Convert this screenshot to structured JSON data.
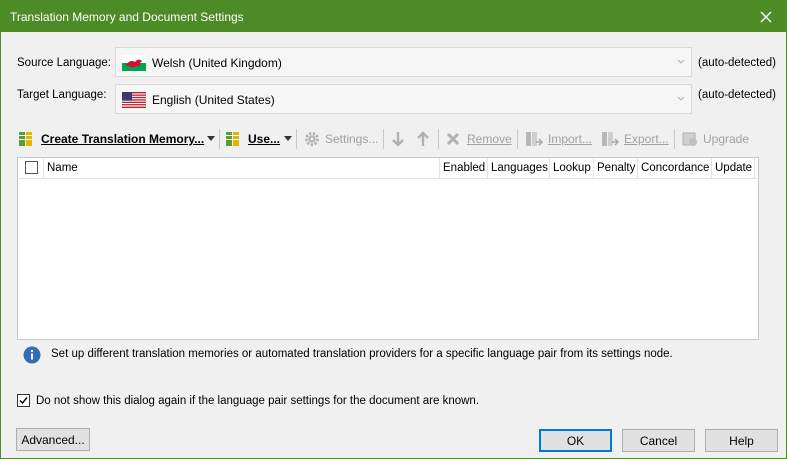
{
  "window": {
    "title": "Translation Memory and Document Settings"
  },
  "source": {
    "label": "Source Language:",
    "value": "Welsh (United Kingdom)",
    "status": "(auto-detected)"
  },
  "target": {
    "label": "Target Language:",
    "value": "English (United States)",
    "status": "(auto-detected)"
  },
  "toolbar": {
    "create": "Create Translation Memory...",
    "use": "Use...",
    "settings": "Settings...",
    "remove": "Remove",
    "import": "Import...",
    "export": "Export...",
    "upgrade": "Upgrade"
  },
  "grid": {
    "columns": [
      "Name",
      "Enabled",
      "Languages",
      "Lookup",
      "Penalty",
      "Concordance",
      "Update"
    ]
  },
  "info": {
    "text": "Set up different translation memories or automated translation providers for a specific language pair from its settings node."
  },
  "option": {
    "dont_show": "Do not show this dialog again if the language pair settings for the document are known.",
    "checked": true
  },
  "buttons": {
    "advanced": "Advanced...",
    "ok": "OK",
    "cancel": "Cancel",
    "help": "Help"
  },
  "colors": {
    "titlebar": "#4c8b25",
    "accent": "#0078d7"
  }
}
